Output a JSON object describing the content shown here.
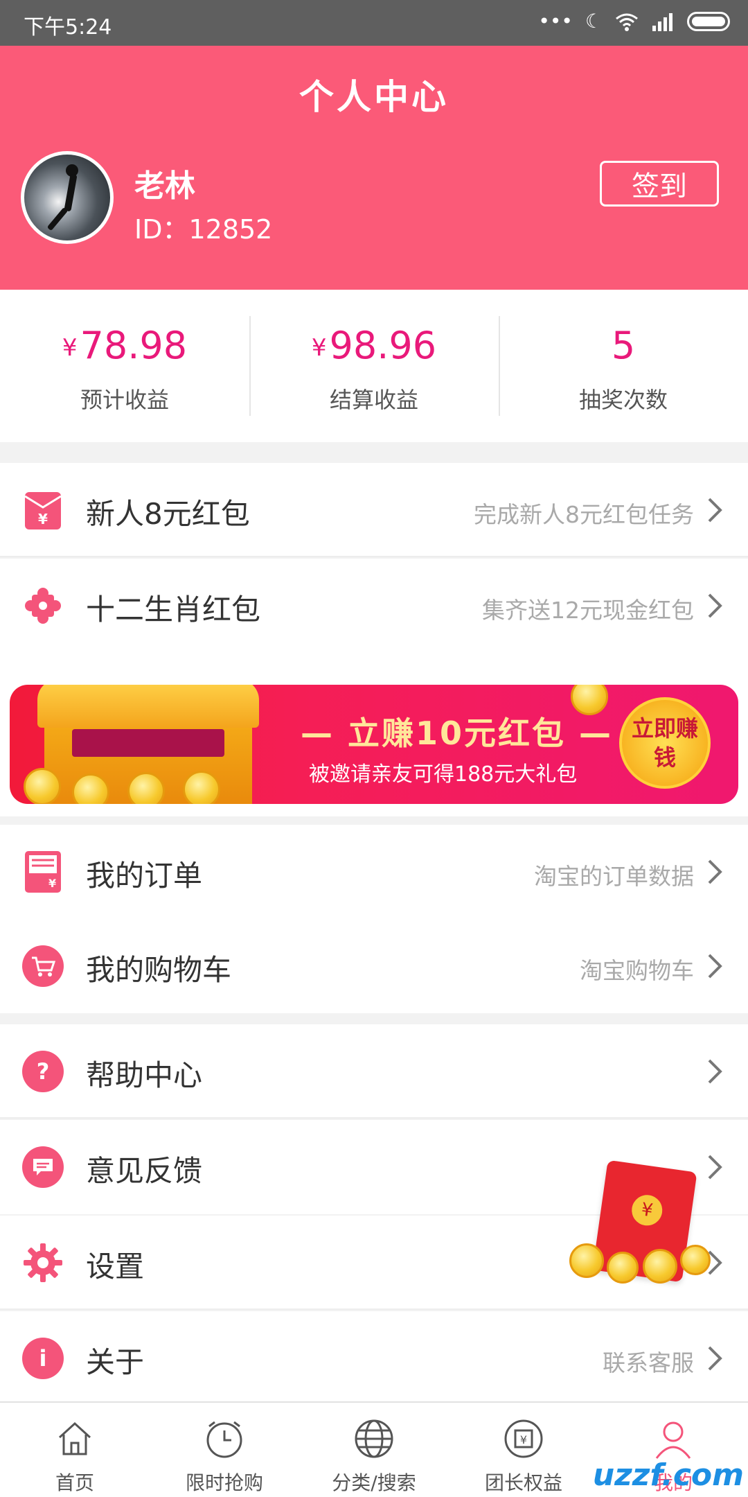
{
  "status_bar": {
    "time": "下午5:24",
    "icons": [
      "dots-icon",
      "moon-icon",
      "wifi-icon",
      "signal-icon",
      "battery-icon"
    ]
  },
  "header": {
    "title": "个人中心",
    "username": "老林",
    "user_id": "ID：12852",
    "signin_label": "签到",
    "bg_color": "#fb5a78"
  },
  "stats": [
    {
      "currency": "¥",
      "value": "78.98",
      "label": "预计收益"
    },
    {
      "currency": "¥",
      "value": "98.96",
      "label": "结算收益"
    },
    {
      "currency": "",
      "value": "5",
      "label": "抽奖次数"
    }
  ],
  "menu_group1": [
    {
      "icon": "red-envelope-icon",
      "label": "新人8元红包",
      "hint": "完成新人8元红包任务"
    },
    {
      "icon": "puzzle-icon",
      "label": "十二生肖红包",
      "hint": "集齐送12元现金红包"
    }
  ],
  "banner": {
    "headline": "— 立赚10元红包 —",
    "subline": "被邀请亲友可得188元大礼包",
    "cta": "立即赚钱"
  },
  "menu_group2": [
    {
      "icon": "order-icon",
      "label": "我的订单",
      "hint": "淘宝的订单数据"
    },
    {
      "icon": "cart-icon",
      "label": "我的购物车",
      "hint": "淘宝购物车"
    }
  ],
  "menu_group3": [
    {
      "icon": "help-icon",
      "label": "帮助中心",
      "hint": ""
    },
    {
      "icon": "feedback-icon",
      "label": "意见反馈",
      "hint": ""
    },
    {
      "icon": "settings-icon",
      "label": "设置",
      "hint": ""
    },
    {
      "icon": "info-icon",
      "label": "关于",
      "hint": "联系客服"
    }
  ],
  "tabbar": [
    {
      "icon": "home-icon",
      "label": "首页",
      "active": false
    },
    {
      "icon": "clock-icon",
      "label": "限时抢购",
      "active": false
    },
    {
      "icon": "globe-icon",
      "label": "分类/搜索",
      "active": false
    },
    {
      "icon": "shield-yen-icon",
      "label": "团长权益",
      "active": false
    },
    {
      "icon": "person-icon",
      "label": "我的",
      "active": true
    }
  ],
  "watermark": "uzzf.com",
  "colors": {
    "accent": "#f4547a",
    "value_pink": "#e9197a"
  }
}
